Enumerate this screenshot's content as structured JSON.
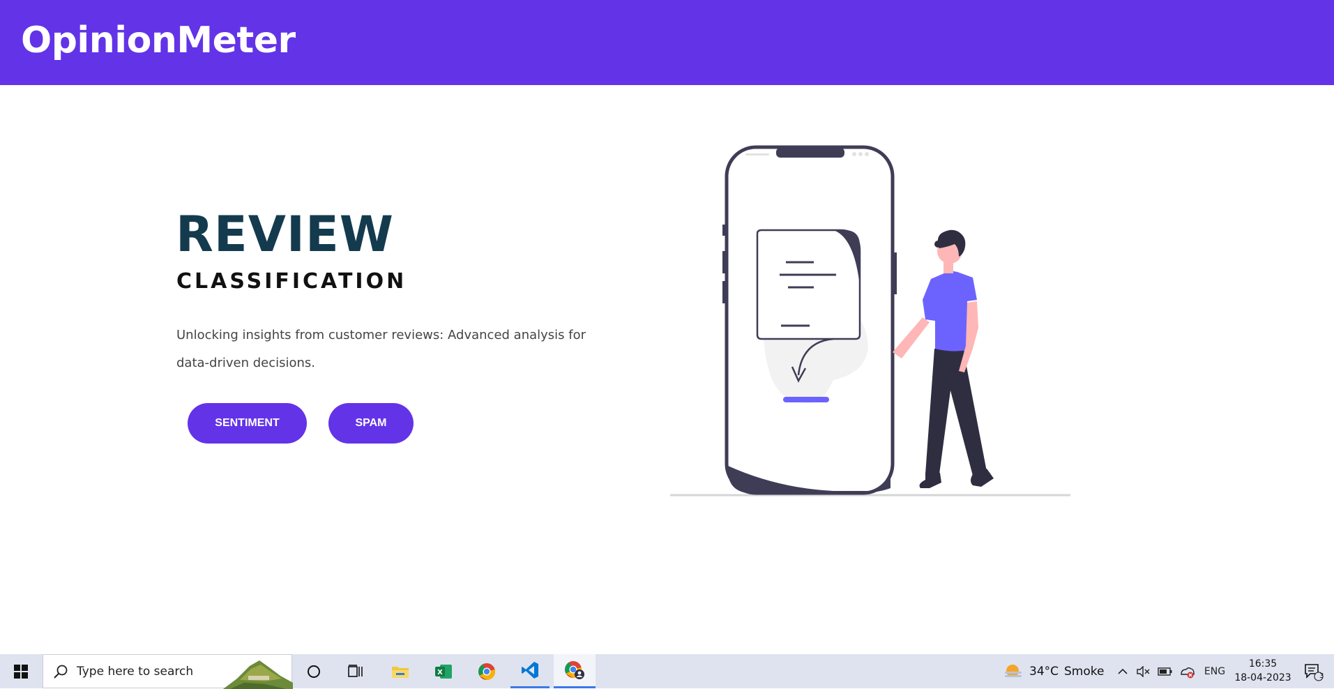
{
  "header": {
    "brand": "OpinionMeter"
  },
  "hero": {
    "title": "REVIEW",
    "subtitle": "CLASSIFICATION",
    "description": "Unlocking insights from customer reviews: Advanced analysis for data-driven decisions.",
    "buttons": [
      {
        "label": "SENTIMENT"
      },
      {
        "label": "SPAM"
      }
    ]
  },
  "colors": {
    "accent": "#6333e8",
    "title": "#143a4e",
    "illustration_dark": "#3f3d56",
    "illustration_accent": "#6c63ff"
  },
  "taskbar": {
    "search_placeholder": "Type here to search",
    "apps": [
      "windows-start-icon",
      "cortana-icon",
      "task-view-icon",
      "file-explorer-icon",
      "excel-icon",
      "chrome-icon",
      "vscode-icon",
      "chrome-profile-icon"
    ],
    "weather": {
      "temp": "34°C",
      "condition": "Smoke"
    },
    "language": "ENG",
    "time": "16:35",
    "date": "18-04-2023",
    "notification_count": "3"
  }
}
